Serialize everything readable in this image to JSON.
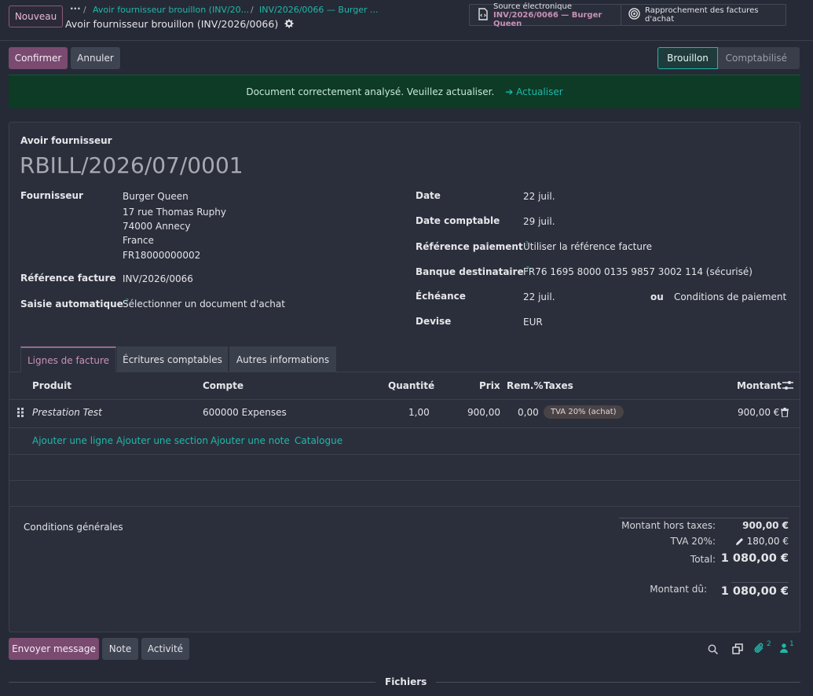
{
  "topbar": {
    "new_label": "Nouveau",
    "breadcrumb_dots": "···",
    "breadcrumbs": [
      "Avoir fournisseur brouillon (INV/20...",
      "INV/2026/0066 — Burger ..."
    ],
    "separator": "/",
    "record_title": "Avoir fournisseur brouillon (INV/2026/0066)",
    "smart_buttons": {
      "source_label": "Source électronique",
      "source_value": "INV/2026/0066 — Burger Queen",
      "reconcile_label": "Rapprochement des factures d'achat"
    }
  },
  "actions": {
    "confirm": "Confirmer",
    "cancel": "Annuler"
  },
  "status": {
    "draft": "Brouillon",
    "posted": "Comptabilisé"
  },
  "alert": {
    "message": "Document correctement analysé. Veuillez actualiser.",
    "link": "Actualiser"
  },
  "form": {
    "doc_type": "Avoir fournisseur",
    "name": "RBILL/2026/07/0001",
    "vendor_label": "Fournisseur",
    "vendor_lines": [
      "Burger Queen",
      "17 rue Thomas Ruphy",
      "74000 Annecy",
      "France",
      "FR18000000002"
    ],
    "bill_ref_label": "Référence facture",
    "bill_ref": "INV/2026/0066",
    "auto_complete_label": "Saisie automatique",
    "auto_complete_placeholder": "Sélectionner un document d'achat",
    "date_label": "Date",
    "date": "22 juil.",
    "acc_date_label": "Date comptable",
    "acc_date": "29 juil.",
    "payment_ref_label": "Référence paiement",
    "payment_ref_placeholder": "Utiliser la référence facture",
    "bank_label": "Banque destinataire",
    "bank": "FR76 1695 8000 0135 9857 3002 114 (sécurisé)",
    "due_label": "Échéance",
    "due": "22 juil.",
    "due_or": "ou",
    "payment_terms_placeholder": "Conditions de paiement",
    "currency_label": "Devise",
    "currency": "EUR",
    "help_mark": "?"
  },
  "tabs": [
    "Lignes de facture",
    "Écritures comptables",
    "Autres informations"
  ],
  "table": {
    "headers": {
      "product": "Produit",
      "account": "Compte",
      "quantity": "Quantité",
      "price": "Prix",
      "discount": "Rem.%",
      "taxes": "Taxes",
      "amount": "Montant"
    },
    "rows": [
      {
        "product": "Prestation Test",
        "account": "600000 Expenses",
        "quantity": "1,00",
        "price": "900,00",
        "discount": "0,00",
        "tax": "TVA 20% (achat)",
        "amount": "900,00 €"
      }
    ],
    "add_links": [
      "Ajouter une ligne",
      "Ajouter une section",
      "Ajouter une note",
      "Catalogue"
    ]
  },
  "footer": {
    "terms_placeholder": "Conditions générales",
    "untaxed_label": "Montant hors taxes:",
    "untaxed": "900,00 €",
    "vat_label": "TVA 20%:",
    "vat": "180,00 €",
    "total_label": "Total:",
    "total": "1 080,00 €",
    "due_label": "Montant dû:",
    "due": "1 080,00 €"
  },
  "chatter": {
    "send_message": "Envoyer message",
    "note": "Note",
    "activity": "Activité",
    "attachments_count": "2",
    "followers_count": "1",
    "files": "Fichiers"
  },
  "colors": {
    "accent": "#1fb8a9",
    "primary": "#7a4a71",
    "alert_bg": "#0d3b26",
    "sheet_bg": "#2b2f3c"
  }
}
